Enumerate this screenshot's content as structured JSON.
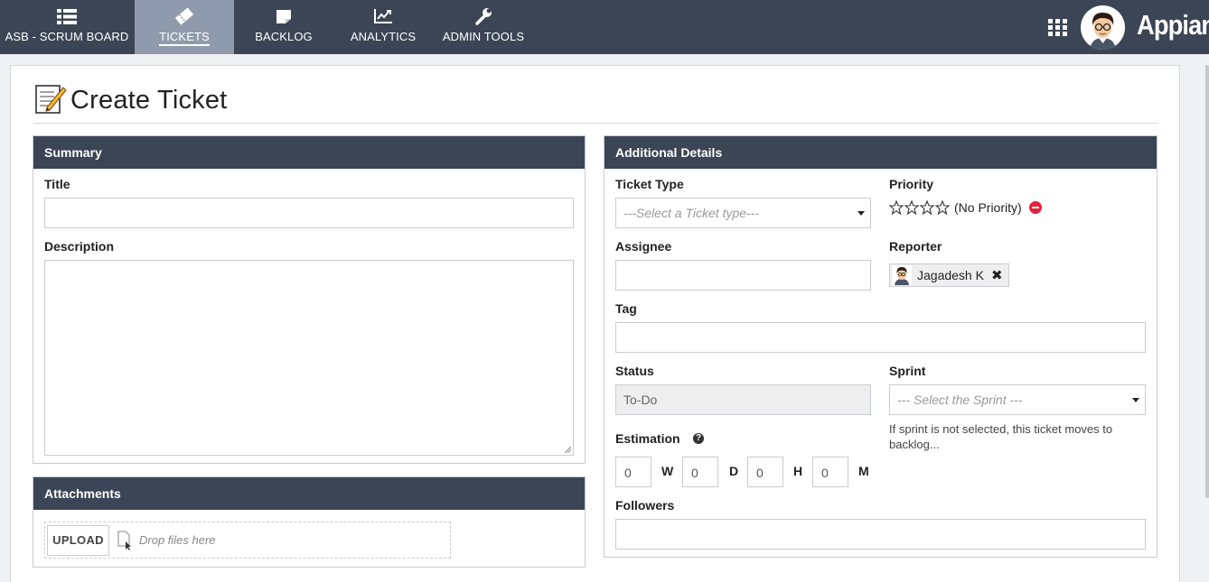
{
  "nav": {
    "tabs": [
      {
        "label": "ASB - SCRUM BOARD",
        "icon": "list-icon"
      },
      {
        "label": "TICKETS",
        "icon": "ticket-icon",
        "active": true
      },
      {
        "label": "BACKLOG",
        "icon": "note-icon"
      },
      {
        "label": "ANALYTICS",
        "icon": "chart-line-icon"
      },
      {
        "label": "ADMIN TOOLS",
        "icon": "wrench-icon"
      }
    ],
    "brand": "Appian",
    "colors": {
      "bar": "#3b4556",
      "active_tab": "#8f9bad"
    }
  },
  "page": {
    "title": "Create Ticket"
  },
  "summary": {
    "header": "Summary",
    "title_label": "Title",
    "title_value": "",
    "description_label": "Description",
    "description_value": ""
  },
  "attachments": {
    "header": "Attachments",
    "upload_label": "UPLOAD",
    "drop_text": "Drop files here"
  },
  "details": {
    "header": "Additional Details",
    "ticket_type_label": "Ticket Type",
    "ticket_type_placeholder": "---Select a Ticket type---",
    "priority_label": "Priority",
    "priority_text": "(No Priority)",
    "priority_stars": 0,
    "assignee_label": "Assignee",
    "reporter_label": "Reporter",
    "reporter_name": "Jagadesh K",
    "tag_label": "Tag",
    "status_label": "Status",
    "status_value": "To-Do",
    "sprint_label": "Sprint",
    "sprint_placeholder": "--- Select the Sprint ---",
    "sprint_hint": "If sprint is not selected, this ticket moves to backlog...",
    "estimation_label": "Estimation",
    "estimation": [
      {
        "value": "0",
        "unit": "W"
      },
      {
        "value": "0",
        "unit": "D"
      },
      {
        "value": "0",
        "unit": "H"
      },
      {
        "value": "0",
        "unit": "M"
      }
    ],
    "followers_label": "Followers"
  }
}
